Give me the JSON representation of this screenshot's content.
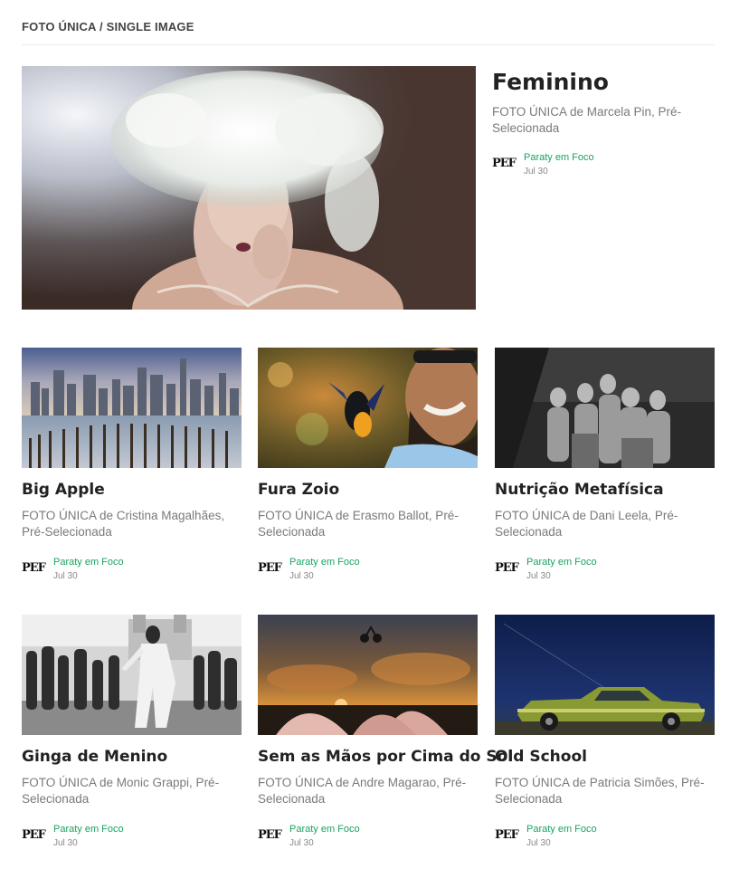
{
  "section": {
    "title": "FOTO ÚNICA / SINGLE IMAGE"
  },
  "publication": {
    "logo_text": "PEF",
    "name": "Paraty em Foco",
    "date": "Jul 30",
    "accent": "#1aa35e"
  },
  "featured": {
    "title": "Feminino",
    "subtitle": "FOTO ÚNICA de Marcela Pin, Pré-Selecionada",
    "image": "portrait-feather-headdress",
    "publication": "Paraty em Foco",
    "date": "Jul 30"
  },
  "cards": [
    {
      "title": "Big Apple",
      "subtitle": "FOTO ÚNICA de Cristina Magalhães, Pré-Selecionada",
      "image": "city-skyline-piers",
      "publication": "Paraty em Foco",
      "date": "Jul 30"
    },
    {
      "title": "Fura Zoio",
      "subtitle": "FOTO ÚNICA de Erasmo Ballot, Pré-Selecionada",
      "image": "bird-and-smiling-man",
      "publication": "Paraty em Foco",
      "date": "Jul 30"
    },
    {
      "title": "Nutrição Metafísica",
      "subtitle": "FOTO ÚNICA de Dani Leela, Pré-Selecionada",
      "image": "women-group-bw",
      "publication": "Paraty em Foco",
      "date": "Jul 30"
    },
    {
      "title": "Ginga de Menino",
      "subtitle": "FOTO ÚNICA de Monic Grappi, Pré-Selecionada",
      "image": "capoeira-crowd-bw",
      "publication": "Paraty em Foco",
      "date": "Jul 30"
    },
    {
      "title": "Sem as Mãos por Cima do Sol",
      "subtitle": "FOTO ÚNICA de Andre Magarao, Pré-Selecionada",
      "image": "bmx-jump-sunset",
      "publication": "Paraty em Foco",
      "date": "Jul 30"
    },
    {
      "title": "Old School",
      "subtitle": "FOTO ÚNICA de Patricia Simões, Pré-Selecionada",
      "image": "green-vintage-car-night",
      "publication": "Paraty em Foco",
      "date": "Jul 30"
    }
  ]
}
